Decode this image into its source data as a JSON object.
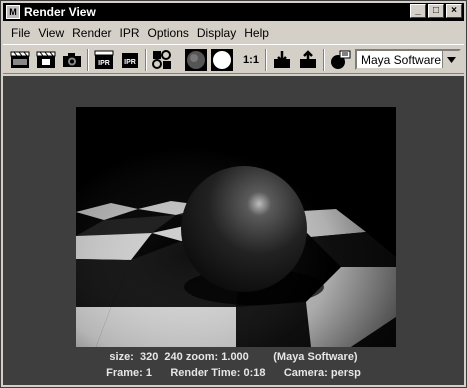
{
  "window": {
    "title": "Render View",
    "app_icon": "maya-icon",
    "controls": {
      "minimize": "_",
      "maximize": "□",
      "close": "×"
    }
  },
  "menu": [
    "File",
    "View",
    "Render",
    "IPR",
    "Options",
    "Display",
    "Help"
  ],
  "toolbar": {
    "icons": [
      "render-frame-icon",
      "render-region-icon",
      "snapshot-icon",
      "ipr-render-icon",
      "ipr-refresh-icon",
      "render-settings-icon",
      "rgb-channels-icon",
      "alpha-channel-icon",
      "keep-image-icon",
      "remove-image-icon",
      "render-globals-icon"
    ],
    "ratio_label": "1:1",
    "renderer": "Maya Software"
  },
  "status": {
    "line1": "size:  320  240 zoom: 1.000        (Maya Software)",
    "line2": "Frame: 1      Render Time: 0:18      Camera: persp"
  }
}
